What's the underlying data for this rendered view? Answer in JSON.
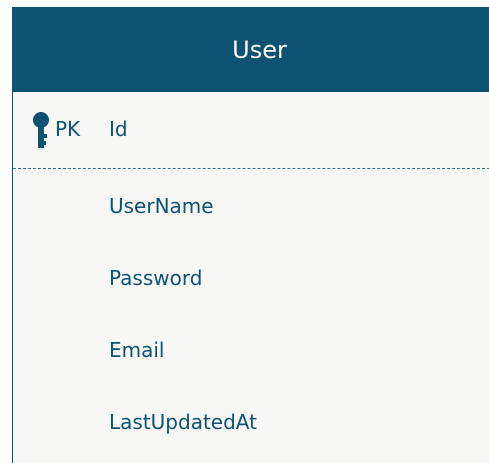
{
  "entity": {
    "title": "User",
    "primary_key": {
      "marker": "PK",
      "name": "Id",
      "icon": "key-icon"
    },
    "attributes": [
      {
        "name": "UserName"
      },
      {
        "name": "Password"
      },
      {
        "name": "Email"
      },
      {
        "name": "LastUpdatedAt"
      }
    ]
  },
  "colors": {
    "header_background": "#0e5273",
    "header_text": "#ffffff",
    "body_background": "#f7f7f5",
    "field_text": "#0e5273",
    "key_icon": "#0e5273"
  }
}
